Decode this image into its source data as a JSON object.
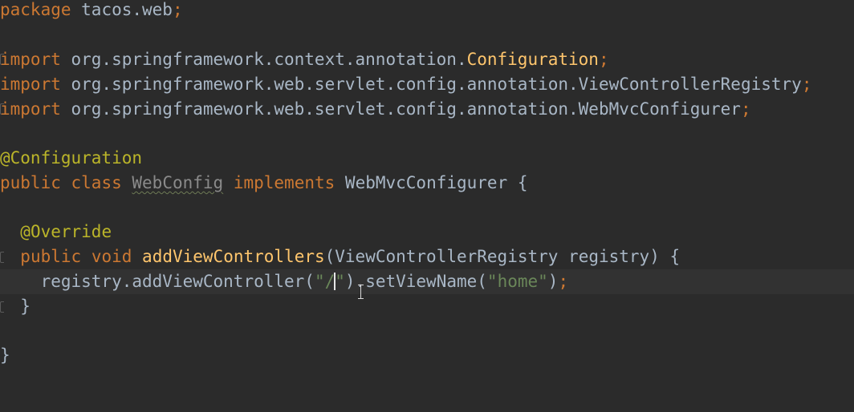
{
  "code": {
    "package_kw": "package",
    "package_name": " tacos.web",
    "semicolon": ";",
    "import_kw": "import",
    "import1_path": " org.springframework.context.annotation.",
    "import1_class": "Configuration",
    "import2_path": " org.springframework.web.servlet.config.annotation.ViewControllerRegistry",
    "import3_path": " org.springframework.web.servlet.config.annotation.WebMvcConfigurer",
    "annotation_configuration": "@Configuration",
    "public_kw": "public",
    "class_kw": "class",
    "class_name": "WebConfig",
    "implements_kw": "implements",
    "interface_name": " WebMvcConfigurer {",
    "annotation_override": "@Override",
    "void_kw": "void",
    "method_name": "addViewControllers",
    "method_params": "(ViewControllerRegistry registry) {",
    "body_call_start": "registry.addViewController(",
    "path_string_open": "\"/",
    "path_string_close": "\"",
    "body_call_mid": ").setViewName(",
    "view_name_string": "\"home\"",
    "body_call_end": ")",
    "close_brace": "}"
  },
  "colors": {
    "background": "#2b2b2b",
    "keyword": "#cc7832",
    "annotation": "#bbb529",
    "method": "#ffc66d",
    "string": "#6a8759",
    "text": "#a9b7c6"
  },
  "icons": {
    "cursor": "text-cursor-ibeam-icon",
    "fold": "fold-marker-icon"
  }
}
